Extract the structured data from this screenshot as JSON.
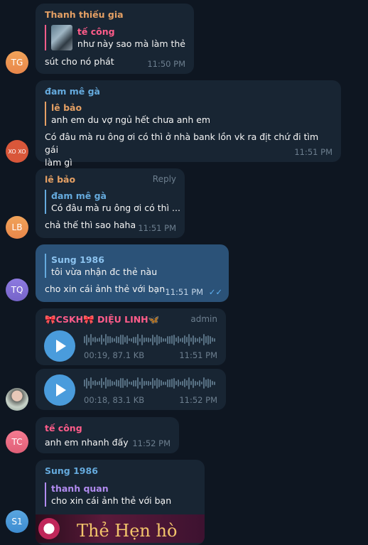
{
  "messages": {
    "m1": {
      "sender": "Thanh thiếu gia",
      "reply_name": "tế công",
      "reply_text": "như này sao mà làm thẻ",
      "text": "sút cho nó phát",
      "time": "11:50 PM",
      "avatar": "TG"
    },
    "m2": {
      "sender": "đam mê gà",
      "reply_name": "lê bảo",
      "reply_text": "anh  em du vợ ngủ hết chưa anh em",
      "text_line1": "Có đâu mà ru ông ơi có thì ở nhà bank lồn vk ra địt chứ đi tìm gái",
      "text_line2": "làm gì",
      "time": "11:51 PM",
      "avatar": "XO XO"
    },
    "m3": {
      "sender": "lê bảo",
      "reply_label": "Reply",
      "reply_name": "đam mê gà",
      "reply_text": "Có đâu mà ru ông ơi có thì ...",
      "text": "chả thế thì sao haha",
      "time": "11:51 PM",
      "avatar": "LB"
    },
    "m4": {
      "reply_name": "Sung 1986",
      "reply_text": "tôi vừa nhận đc thẻ nàu",
      "text": "cho xin cái ảnh thẻ với bạn",
      "time": "11:51 PM",
      "avatar": "TQ"
    },
    "m5": {
      "sender": "🎀CSKH🎀 DIỆU LINH🦋",
      "badge": "admin",
      "meta": "00:19, 87.1 KB",
      "time": "11:51 PM"
    },
    "m6": {
      "meta": "00:18, 83.1 KB",
      "time": "11:52 PM"
    },
    "m7": {
      "sender": "tế công",
      "text": "anh em nhanh đấy",
      "time": "11:52 PM",
      "avatar": "TC"
    },
    "m8": {
      "sender": "Sung 1986",
      "reply_name": "thanh quan",
      "reply_text": "cho xin cái ảnh thẻ với bạn",
      "image_text": "Thẻ Hẹn hò",
      "avatar": "S1"
    }
  },
  "colors": {
    "bg": "#0e1621",
    "bubble_in": "#182533",
    "bubble_out": "#2b5278",
    "orange": "#e5a064",
    "red": "#ff5c8a",
    "blue": "#65aadd",
    "purple": "#b18bf0",
    "play": "#4a9cdc"
  }
}
